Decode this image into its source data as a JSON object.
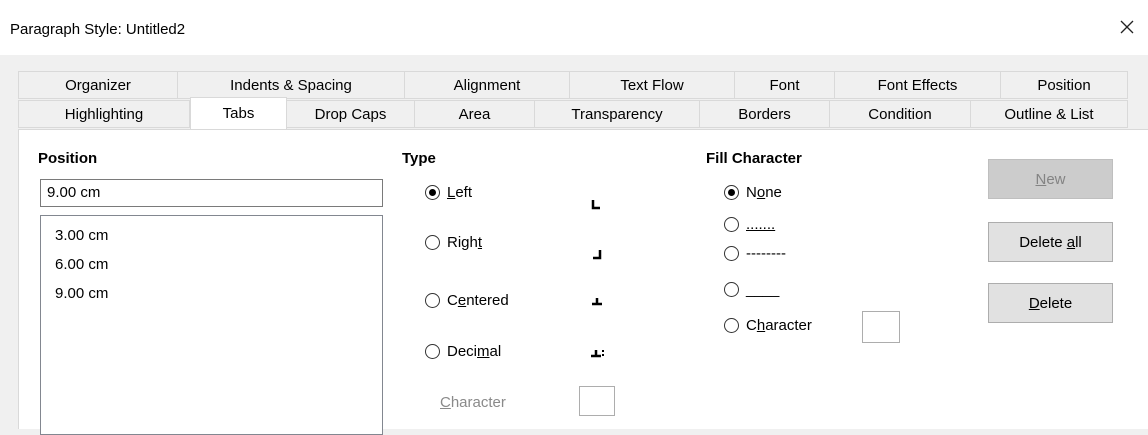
{
  "window": {
    "title": "Paragraph Style: Untitled2"
  },
  "tabs": {
    "row1": [
      "Organizer",
      "Indents & Spacing",
      "Alignment",
      "Text Flow",
      "Font",
      "Font Effects",
      "Position"
    ],
    "row2": [
      "Highlighting",
      "Tabs",
      "Drop Caps",
      "Area",
      "Transparency",
      "Borders",
      "Condition",
      "Outline & List"
    ],
    "active": "Tabs"
  },
  "position": {
    "heading": "Position",
    "input_value": "9.00 cm",
    "list": [
      "3.00 cm",
      "6.00 cm",
      "9.00 cm"
    ]
  },
  "type": {
    "heading": "Type",
    "options": [
      {
        "pre": "",
        "key": "L",
        "post": "eft",
        "checked": true
      },
      {
        "pre": "Righ",
        "key": "t",
        "post": "",
        "checked": false
      },
      {
        "pre": "C",
        "key": "e",
        "post": "ntered",
        "checked": false
      },
      {
        "pre": "Deci",
        "key": "m",
        "post": "al",
        "checked": false
      }
    ],
    "character_label_key": "C",
    "character_label_rest": "haracter"
  },
  "fill": {
    "heading": "Fill Character",
    "none_pre": "N",
    "none_key": "o",
    "none_post": "ne",
    "dots": ".......",
    "dashes": "--------",
    "line": "____",
    "character_pre": "C",
    "character_key": "h",
    "character_post": "aracter"
  },
  "buttons": {
    "new_key": "N",
    "new_rest": "ew",
    "delete_all_pre": "Delete ",
    "delete_all_key": "a",
    "delete_all_post": "ll",
    "delete_key": "D",
    "delete_rest": "elete"
  }
}
